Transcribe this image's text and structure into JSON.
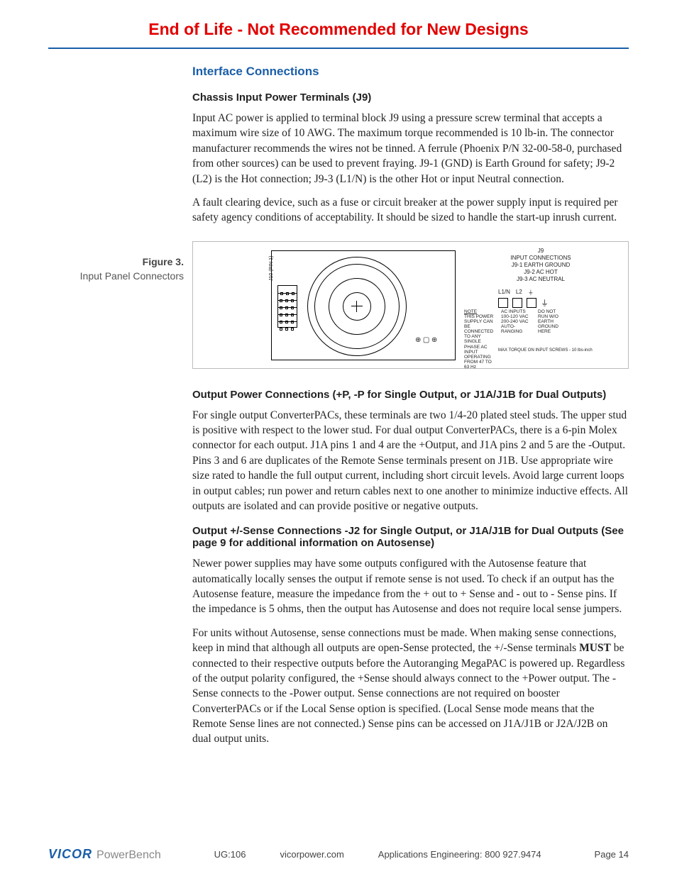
{
  "banner": "End of Life - Not Recommended for New Designs",
  "section_title": "Interface Connections",
  "h_chassis": "Chassis Input Power Terminals (J9)",
  "p_chassis_1": "Input AC power is applied to terminal block J9 using a pressure screw terminal that accepts a maximum wire size of 10 AWG. The maximum torque recommended is 10 lb-in.   The connector manufacturer recommends the wires not be tinned. A ferrule (Phoenix P/N  32-00-58-0, purchased from other sources) can be used to prevent fraying. J9-1 (GND) is Earth Ground for safety; J9-2 (L2) is the Hot connection; J9-3 (L1/N) is the other Hot or input Neutral connection.",
  "p_chassis_2": "A fault clearing device, such as a fuse or circuit breaker at the power supply input is required per safety agency conditions of acceptability. It should be sized to handle the start-up inrush current.",
  "fig_label": "Figure 3.",
  "fig_caption": "Input Panel Connectors",
  "diagram": {
    "j10_label": "J10 (PIN 1)",
    "j9_title": "J9",
    "j9_sub": "INPUT CONNECTIONS",
    "j9_l1": "J9-1 EARTH GROUND",
    "j9_l2": "J9-2 AC HOT",
    "j9_l3": "J9-3 AC NEUTRAL",
    "term_l1n": "L1/N",
    "term_l2": "L2",
    "gnd": "⏚",
    "note_title": "NOTE",
    "note_body": "THIS POWER SUPPLY CAN BE CONNECTED TO ANY SINGLE PHASE AC INPUT OPERATING FROM 47 TO 63 Hz",
    "ac_inputs": "AC INPUTS",
    "ac_v1": "100-120 VAC",
    "ac_v2": "200-240 VAC",
    "auto": "AUTO-",
    "ranging": "RANGING",
    "donot": "DO NOT",
    "runwo": "RUN W/O",
    "earth": "EARTH",
    "ground": "GROUND",
    "here": "HERE",
    "torque": "MAX TORQUE ON INPUT SCREWS - 10 lbs-inch"
  },
  "h_output_power": "Output Power Connections (+P, -P for Single Output, or J1A/J1B for Dual Outputs)",
  "p_output_power": "For single output ConverterPACs, these terminals are two 1/4-20 plated steel studs. The upper stud is positive with respect to the lower stud. For dual output ConverterPACs, there is a 6-pin Molex connector for each output. J1A pins 1 and 4 are the +Output, and J1A pins 2 and 5 are the -Output. Pins 3 and 6 are duplicates of the Remote Sense terminals present on J1B. Use appropriate wire size rated to handle the full output current, including short circuit levels. Avoid large current loops in output cables; run power and return cables next to one another to minimize inductive effects. All outputs are isolated and can provide positive or negative outputs.",
  "h_output_sense": "Output +/-Sense Connections -J2 for Single Output, or J1A/J1B for Dual Outputs (See page 9 for additional information on Autosense)",
  "p_sense_1": "Newer power supplies may have some outputs configured with the Autosense feature that automatically locally senses the output if remote sense is not used.  To check if an output has the Autosense feature, measure the impedance from the + out to + Sense and - out to - Sense pins.  If the impedance is 5 ohms, then the output has Autosense and does not require local sense jumpers.",
  "p_sense_2a": "For units without Autosense, sense connections must be made. When making sense connections, keep in mind that although all outputs are open-Sense protected, the +/-Sense terminals ",
  "p_sense_2_must": "MUST",
  "p_sense_2b": " be connected to their respective outputs before the Autoranging MegaPAC is powered up. Regardless of the output polarity configured, the +Sense should always connect to the +Power output. The -Sense connects to the -Power output. Sense connections are not required on booster ConverterPACs or if the Local Sense option is specified. (Local Sense mode means that the Remote Sense lines are not connected.) Sense pins can be accessed on J1A/J1B or J2A/J2B on dual output units.",
  "footer": {
    "logo1": "VICOR",
    "logo2": "PowerBench",
    "ug": "UG:106",
    "site": "vicorpower.com",
    "apps": "Applications Engineering: 800 927.9474",
    "page": "Page 14"
  }
}
